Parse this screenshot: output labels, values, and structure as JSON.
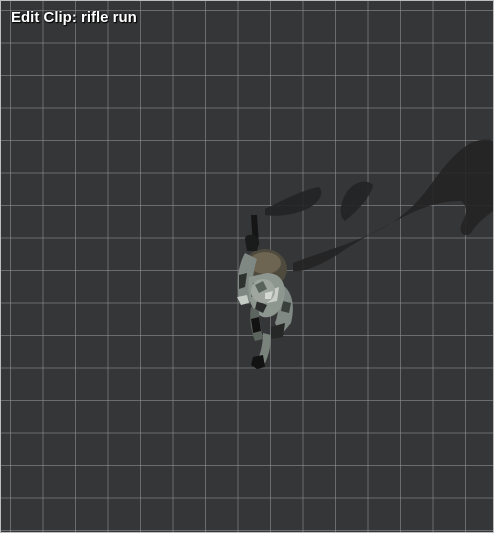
{
  "editor": {
    "title": "Edit Clip: rifle run"
  },
  "scene": {
    "view": "top-down orthographic",
    "grid": true,
    "background_color": "#353637",
    "grid_color": "#96989b",
    "shadow_color": "#232425",
    "character": "soldier-with-rifle",
    "camo_colors": [
      "#8e9690",
      "#4d5550",
      "#c9cec8",
      "#2a2d2b"
    ]
  }
}
